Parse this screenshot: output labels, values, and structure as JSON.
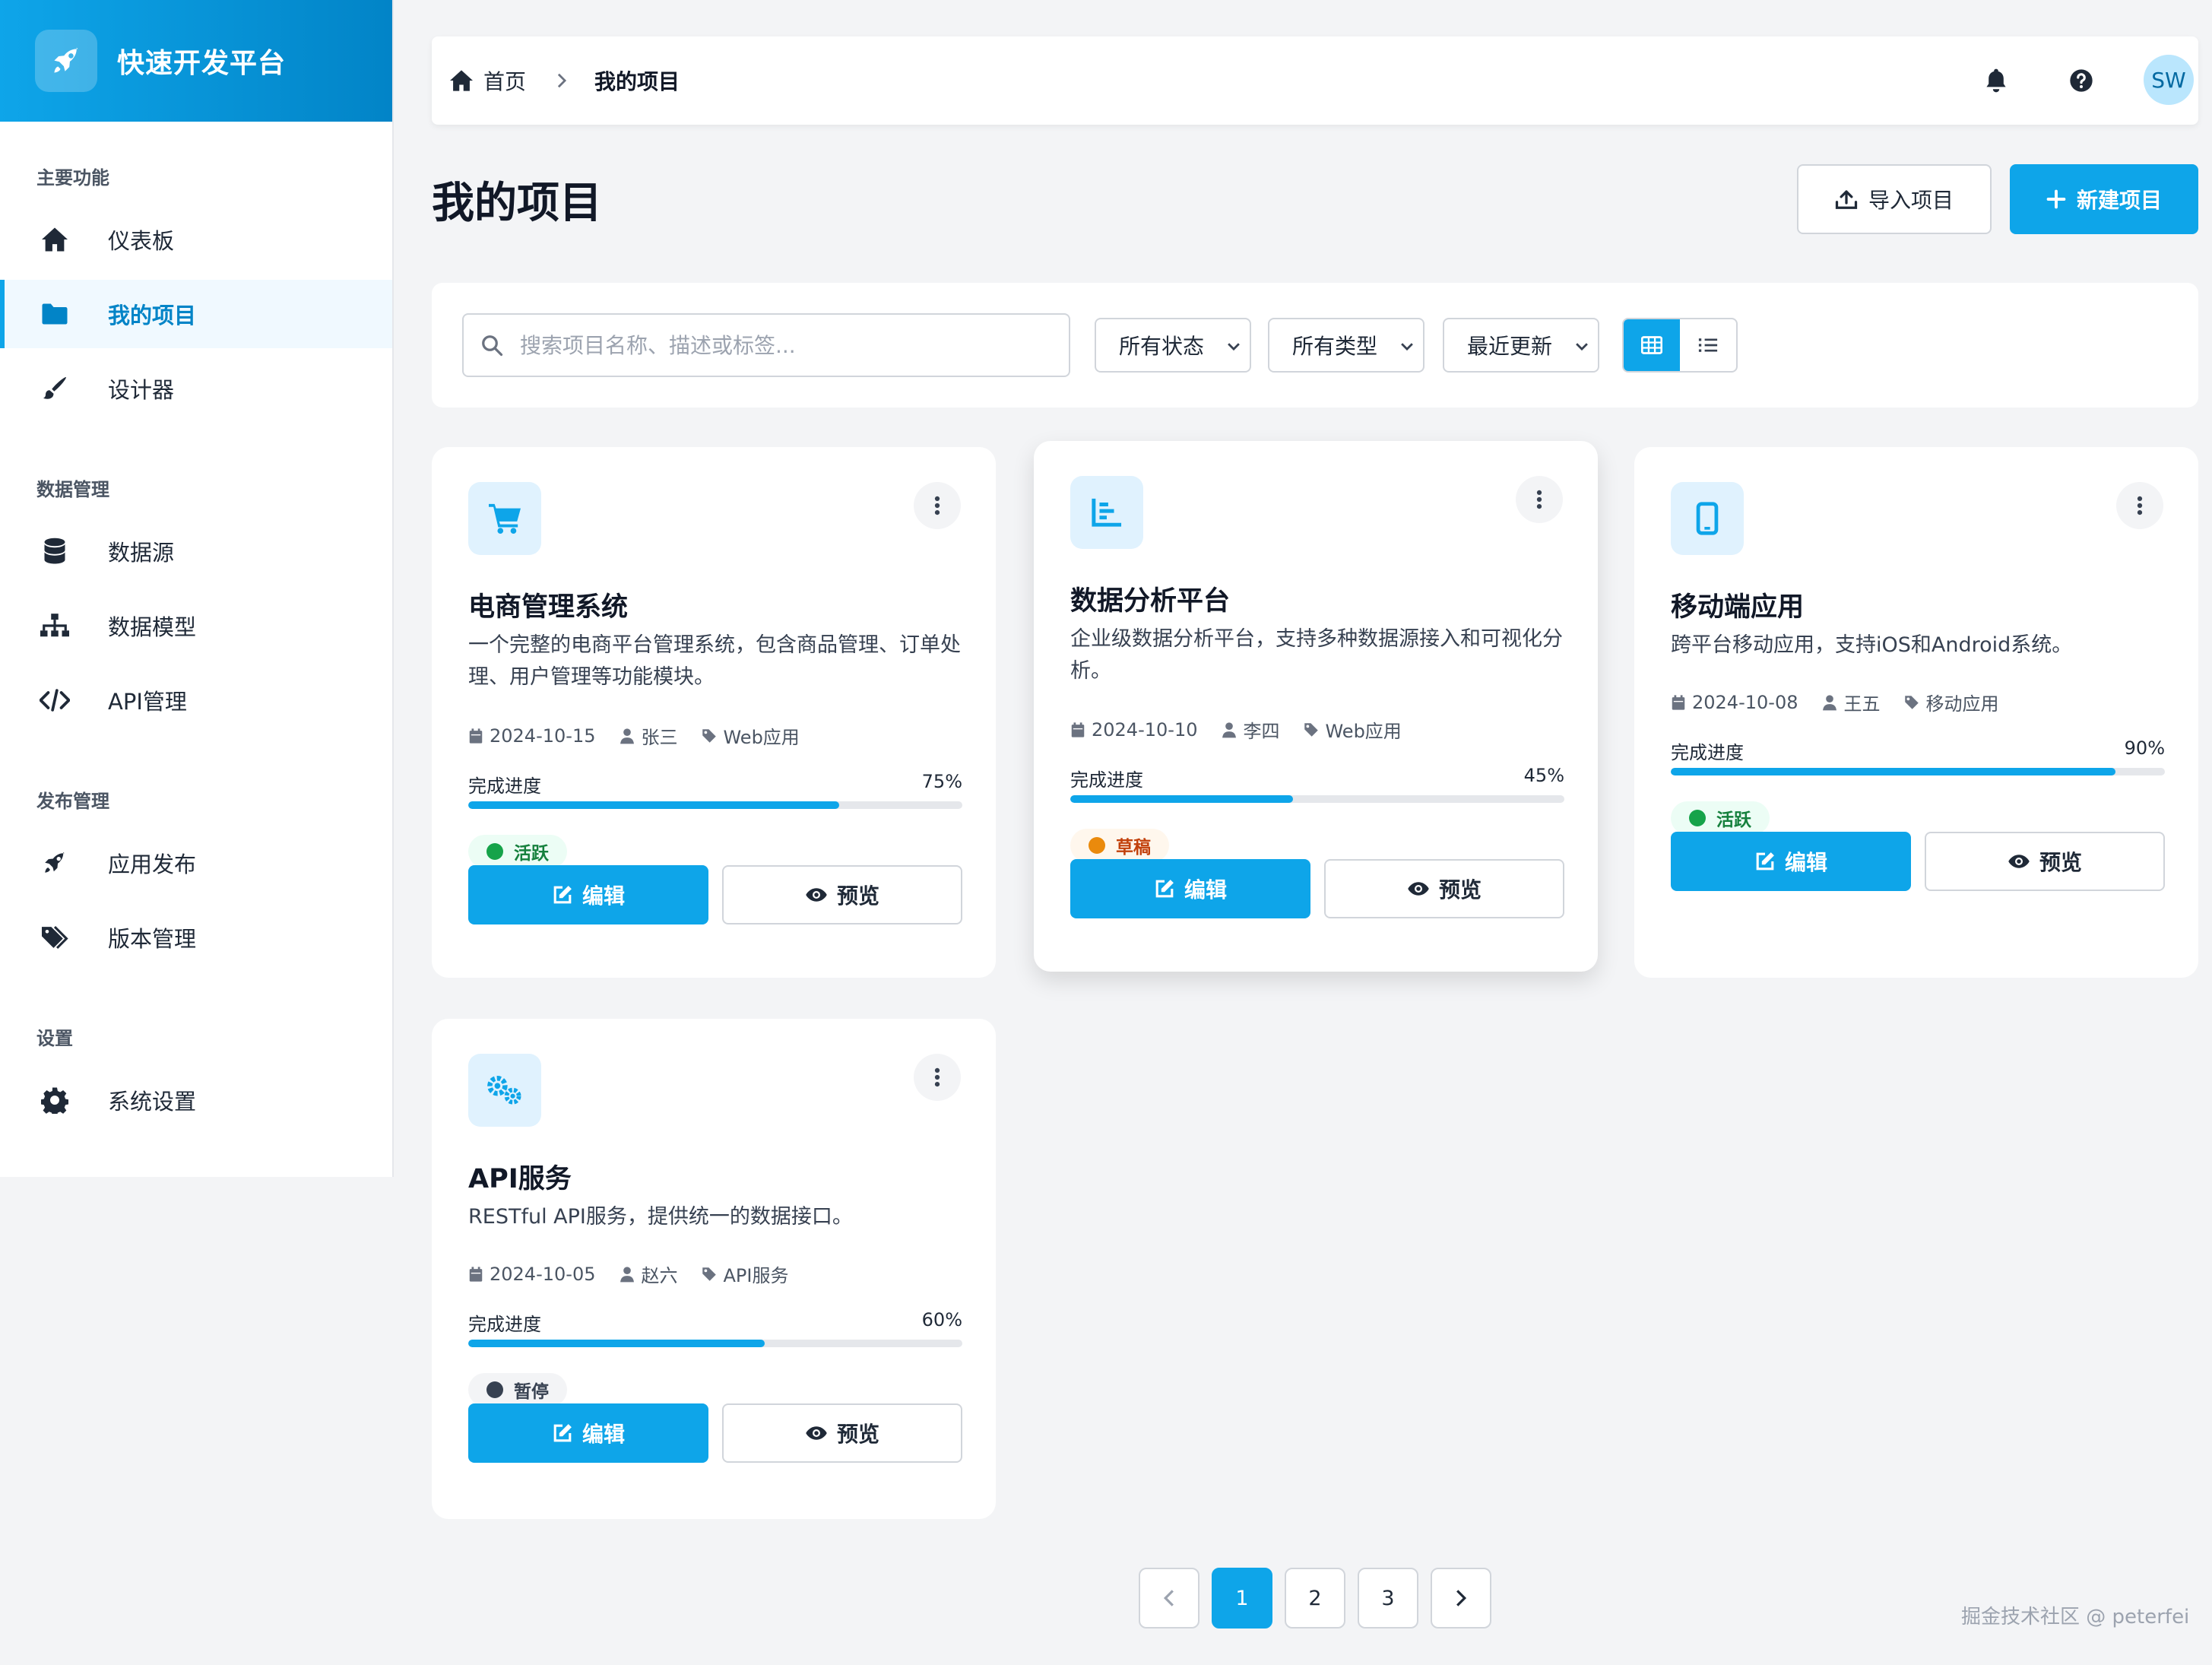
{
  "brand": {
    "title": "快速开发平台",
    "logo_icon": "rocket-icon"
  },
  "sidebar": {
    "sections": [
      {
        "title": "主要功能"
      },
      {
        "title": "数据管理"
      },
      {
        "title": "发布管理"
      },
      {
        "title": "设置"
      }
    ],
    "items": [
      {
        "label": "仪表板",
        "icon": "home-icon"
      },
      {
        "label": "我的项目",
        "icon": "folder-icon",
        "active": true
      },
      {
        "label": "设计器",
        "icon": "brush-icon"
      },
      {
        "label": "数据源",
        "icon": "database-icon"
      },
      {
        "label": "数据模型",
        "icon": "sitemap-icon"
      },
      {
        "label": "API管理",
        "icon": "code-icon"
      },
      {
        "label": "应用发布",
        "icon": "rocket-icon"
      },
      {
        "label": "版本管理",
        "icon": "tags-icon"
      },
      {
        "label": "系统设置",
        "icon": "gear-icon"
      }
    ]
  },
  "header": {
    "breadcrumb": {
      "home": "首页",
      "current": "我的项目"
    },
    "avatar": "SW"
  },
  "page": {
    "title": "我的项目",
    "import_label": "导入项目",
    "new_label": "新建项目"
  },
  "filters": {
    "search_placeholder": "搜索项目名称、描述或标签...",
    "status": "所有状态",
    "type": "所有类型",
    "sort": "最近更新",
    "view_mode": "grid"
  },
  "progress_label": "完成进度",
  "edit_label": "编辑",
  "preview_label": "预览",
  "projects": [
    {
      "title": "电商管理系统",
      "desc": "一个完整的电商平台管理系统，包含商品管理、订单处理、用户管理等功能模块。",
      "date": "2024-10-15",
      "owner": "张三",
      "type": "Web应用",
      "progress": 75,
      "progress_text": "75%",
      "status": "活跃",
      "status_kind": "active",
      "icon": "cart-icon"
    },
    {
      "title": "数据分析平台",
      "desc": "企业级数据分析平台，支持多种数据源接入和可视化分析。",
      "date": "2024-10-10",
      "owner": "李四",
      "type": "Web应用",
      "progress": 45,
      "progress_text": "45%",
      "status": "草稿",
      "status_kind": "draft",
      "icon": "chart-icon"
    },
    {
      "title": "移动端应用",
      "desc": "跨平台移动应用，支持iOS和Android系统。",
      "date": "2024-10-08",
      "owner": "王五",
      "type": "移动应用",
      "progress": 90,
      "progress_text": "90%",
      "status": "活跃",
      "status_kind": "active",
      "icon": "mobile-icon"
    },
    {
      "title": "API服务",
      "desc": "RESTful API服务，提供统一的数据接口。",
      "date": "2024-10-05",
      "owner": "赵六",
      "type": "API服务",
      "progress": 60,
      "progress_text": "60%",
      "status": "暂停",
      "status_kind": "paused",
      "icon": "gears-icon"
    }
  ],
  "pagination": {
    "pages": [
      "1",
      "2",
      "3"
    ],
    "current": "1"
  },
  "watermark": "掘金技术社区 @ peterfei",
  "colors": {
    "accent": "#0ea5e9",
    "active": "#16a34a",
    "draft": "#ea8a0c",
    "paused": "#374151"
  }
}
